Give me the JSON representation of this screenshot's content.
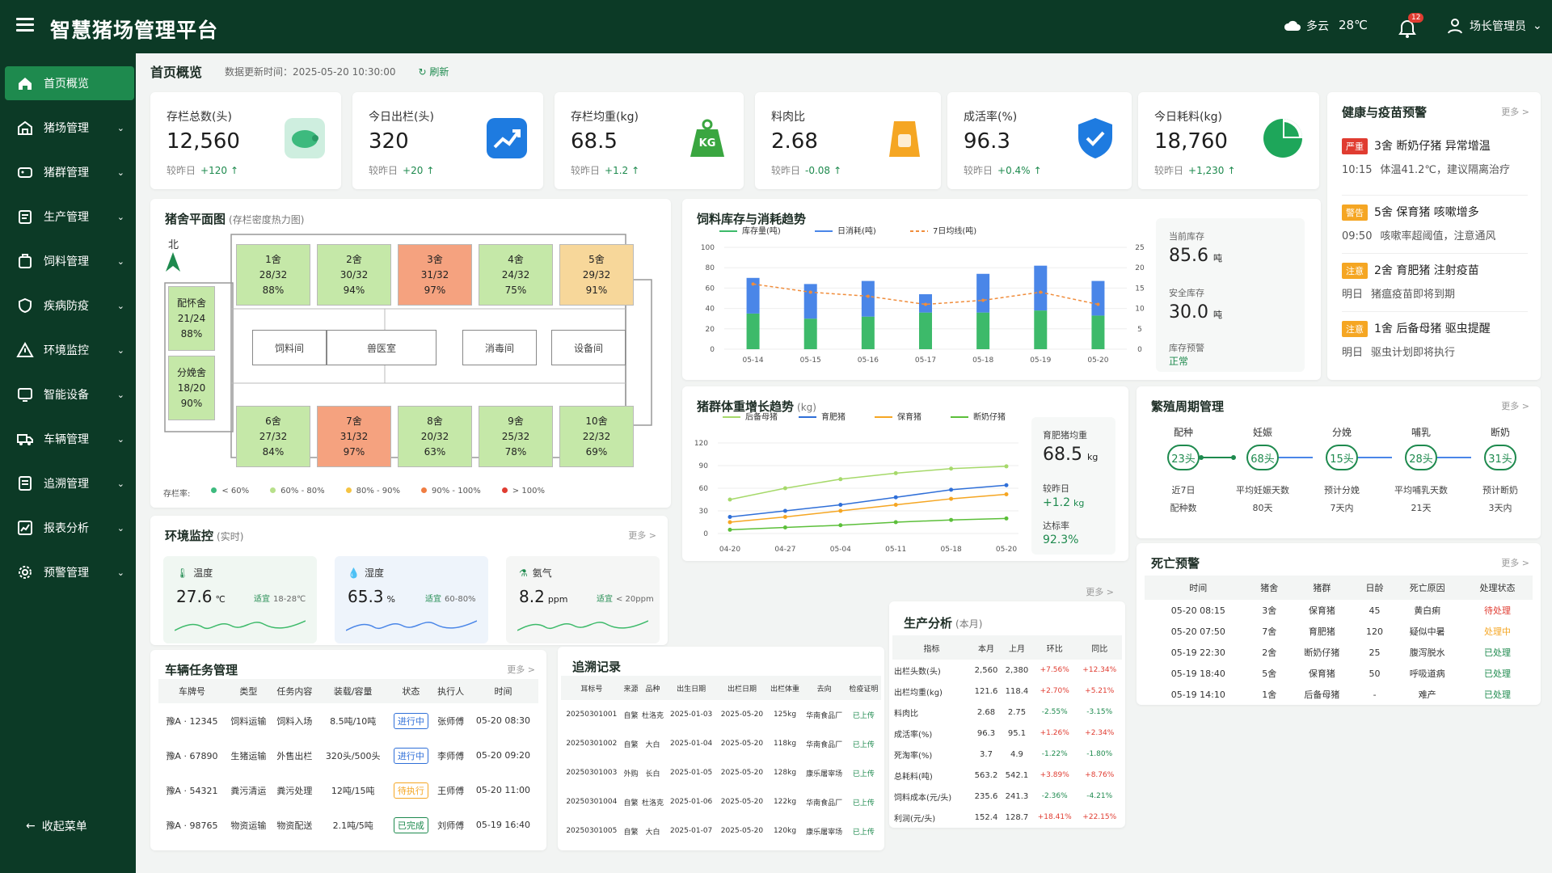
{
  "app": {
    "title": "智慧猪场管理平台"
  },
  "topbar": {
    "weather": "多云",
    "temperature": "28℃",
    "notifications": "12",
    "user": "场长管理员"
  },
  "colors": {
    "brand": "#0c3a26",
    "accent": "#1e8a4e",
    "danger": "#e03c31",
    "warning": "#f5a623"
  },
  "sidebar": {
    "items": [
      {
        "label": "首页概览",
        "icon": "home-icon",
        "active": true
      },
      {
        "label": "猪场管理",
        "icon": "farm-icon"
      },
      {
        "label": "猪群管理",
        "icon": "herd-icon"
      },
      {
        "label": "生产管理",
        "icon": "production-icon"
      },
      {
        "label": "饲料管理",
        "icon": "feed-icon"
      },
      {
        "label": "疾病防疫",
        "icon": "shield-icon"
      },
      {
        "label": "环境监控",
        "icon": "warning-icon"
      },
      {
        "label": "智能设备",
        "icon": "device-icon"
      },
      {
        "label": "车辆管理",
        "icon": "truck-icon"
      },
      {
        "label": "追溯管理",
        "icon": "trace-icon"
      },
      {
        "label": "报表分析",
        "icon": "report-icon"
      },
      {
        "label": "预警管理",
        "icon": "gear-icon"
      }
    ],
    "collapse": "收起菜单"
  },
  "page": {
    "title": "首页概览",
    "update_time": "数据更新时间：2025-05-20 10:30:00",
    "refresh": "刷新"
  },
  "kpis": [
    {
      "label": "存栏总数(头)",
      "value": "12,560",
      "compare": "较昨日",
      "delta": "+120",
      "icon": "pig-icon",
      "color": "#3dba7e"
    },
    {
      "label": "今日出栏(头)",
      "value": "320",
      "compare": "较昨日",
      "delta": "+20",
      "icon": "trend-up-icon",
      "color": "#1e7be0"
    },
    {
      "label": "存栏均重(kg)",
      "value": "68.5",
      "compare": "较昨日",
      "delta": "+1.2",
      "icon": "weight-icon",
      "color": "#3aa640",
      "icon_text": "KG"
    },
    {
      "label": "料肉比",
      "value": "2.68",
      "compare": "较昨日",
      "delta": "-0.08",
      "icon": "feed-bag-icon",
      "color": "#f5a623"
    },
    {
      "label": "成活率(%)",
      "value": "96.3",
      "compare": "较昨日",
      "delta": "+0.4%",
      "icon": "shield-check-icon",
      "color": "#1e7be0"
    },
    {
      "label": "今日耗料(kg)",
      "value": "18,760",
      "compare": "较昨日",
      "delta": "+1,230",
      "icon": "pie-icon",
      "color": "#1ea65a"
    }
  ],
  "floorplan": {
    "title": "猪舍平面图",
    "subtitle": "(存栏密度热力图)",
    "north": "北",
    "rooms_top": [
      {
        "name": "1舍",
        "count": "28/32",
        "rate": "88%",
        "color": "#c5e8a8"
      },
      {
        "name": "2舍",
        "count": "30/32",
        "rate": "94%",
        "color": "#c5e8a8"
      },
      {
        "name": "3舍",
        "count": "31/32",
        "rate": "97%",
        "color": "#f5a27f"
      },
      {
        "name": "4舍",
        "count": "24/32",
        "rate": "75%",
        "color": "#c5e8a8"
      },
      {
        "name": "5舍",
        "count": "29/32",
        "rate": "91%",
        "color": "#f7d79a"
      }
    ],
    "rooms_bottom": [
      {
        "name": "6舍",
        "count": "27/32",
        "rate": "84%",
        "color": "#c5e8a8"
      },
      {
        "name": "7舍",
        "count": "31/32",
        "rate": "97%",
        "color": "#f5a27f"
      },
      {
        "name": "8舍",
        "count": "20/32",
        "rate": "63%",
        "color": "#c5e8a8"
      },
      {
        "name": "9舍",
        "count": "25/32",
        "rate": "78%",
        "color": "#c5e8a8"
      },
      {
        "name": "10舍",
        "count": "22/32",
        "rate": "69%",
        "color": "#c5e8a8"
      }
    ],
    "side_rooms": [
      {
        "name": "配怀舍",
        "count": "21/24",
        "rate": "88%"
      },
      {
        "name": "分娩舍",
        "count": "18/20",
        "rate": "90%"
      }
    ],
    "facilities": [
      "饲料间",
      "兽医室",
      "消毒间",
      "设备间"
    ],
    "legend_title": "存栏率:",
    "legend": [
      {
        "label": "< 60%",
        "color": "#3dba7e"
      },
      {
        "label": "60% - 80%",
        "color": "#b7e08a"
      },
      {
        "label": "80% - 90%",
        "color": "#f5c443"
      },
      {
        "label": "90% - 100%",
        "color": "#f07d42"
      },
      {
        "label": "> 100%",
        "color": "#e03c31"
      }
    ]
  },
  "env": {
    "title": "环境监控",
    "subtitle": "(实时)",
    "more": "更多 >",
    "items": [
      {
        "name": "温度",
        "value": "27.6",
        "unit": "℃",
        "range_label": "适宜",
        "range": "18-28℃",
        "icon": "thermometer-icon"
      },
      {
        "name": "湿度",
        "value": "65.3",
        "unit": "%",
        "range_label": "适宜",
        "range": "60-80%",
        "icon": "droplet-icon"
      },
      {
        "name": "氨气",
        "value": "8.2",
        "unit": "ppm",
        "range_label": "适宜",
        "range": "< 20ppm",
        "icon": "gas-icon"
      }
    ]
  },
  "feed": {
    "title": "饲料库存与消耗趋势",
    "legend": [
      "库存量(吨)",
      "日消耗(吨)",
      "7日均线(吨)"
    ],
    "side": {
      "current_label": "当前库存",
      "current": "85.6",
      "unit": "吨",
      "safe_label": "安全库存",
      "safe": "30.0",
      "alert_label": "库存预警",
      "alert": "正常"
    }
  },
  "weight": {
    "title": "猪群体重增长趋势",
    "subtitle": "(kg)",
    "side": {
      "avg_label": "育肥猪均重",
      "avg": "68.5",
      "unit": "kg",
      "compare_label": "较昨日",
      "compare": "+1.2",
      "rate_label": "达标率",
      "rate": "92.3%"
    }
  },
  "chart_data": [
    {
      "type": "bar",
      "categories": [
        "05-14",
        "05-15",
        "05-16",
        "05-17",
        "05-18",
        "05-19",
        "05-20"
      ],
      "series": [
        {
          "name": "库存量(吨)",
          "values": [
            35,
            30,
            32,
            36,
            36,
            38,
            33
          ],
          "color": "#3dba6a",
          "stack": "total"
        },
        {
          "name": "日消耗(吨)",
          "values": [
            35,
            34,
            35,
            18,
            38,
            44,
            34
          ],
          "color": "#4a86e8",
          "stack": "total"
        },
        {
          "name": "7日均线(吨)",
          "values": [
            16,
            14,
            13,
            11,
            12,
            14,
            11
          ],
          "color": "#f08d3c",
          "type": "line",
          "axis": "right"
        }
      ],
      "ylim": [
        0,
        100
      ],
      "yticks": [
        0,
        20,
        40,
        60,
        80,
        100
      ],
      "y2lim": [
        0,
        25
      ],
      "y2ticks": [
        0,
        5,
        10,
        15,
        20,
        25
      ],
      "grid": true,
      "legend": "top-left"
    },
    {
      "type": "line",
      "categories": [
        "04-20",
        "04-27",
        "05-04",
        "05-11",
        "05-18",
        "05-20"
      ],
      "series": [
        {
          "name": "后备母猪",
          "values": [
            45,
            60,
            72,
            80,
            86,
            89
          ],
          "color": "#a6d96a"
        },
        {
          "name": "育肥猪",
          "values": [
            22,
            30,
            38,
            48,
            58,
            64
          ],
          "color": "#2f6fd8"
        },
        {
          "name": "保育猪",
          "values": [
            15,
            22,
            30,
            38,
            46,
            52
          ],
          "color": "#f5a623"
        },
        {
          "name": "断奶仔猪",
          "values": [
            5,
            8,
            11,
            15,
            18,
            20
          ],
          "color": "#5cbf3a"
        }
      ],
      "ylim": [
        0,
        120
      ],
      "yticks": [
        0,
        30,
        60,
        90,
        120
      ],
      "grid": true,
      "legend": "top-left"
    }
  ],
  "warnings": {
    "title": "健康与疫苗预警",
    "more": "更多 >",
    "items": [
      {
        "tag": "严重",
        "tag_color": "#e03c31",
        "title": "3舍 断奶仔猪 异常增温",
        "time": "10:15",
        "desc": "体温41.2℃，建议隔离治疗"
      },
      {
        "tag": "警告",
        "tag_color": "#f5a623",
        "title": "5舍 保育猪 咳嗽增多",
        "time": "09:50",
        "desc": "咳嗽率超阈值，注意通风"
      },
      {
        "tag": "注意",
        "tag_color": "#f5a623",
        "title": "2舍 育肥猪 注射疫苗",
        "time": "明日",
        "desc": "猪瘟疫苗即将到期"
      },
      {
        "tag": "注意",
        "tag_color": "#f5a623",
        "title": "1舍 后备母猪 驱虫提醒",
        "time": "明日",
        "desc": "驱虫计划即将执行"
      }
    ]
  },
  "breeding": {
    "title": "繁殖周期管理",
    "more": "更多 >",
    "stages": [
      {
        "label": "配种",
        "value": "23头",
        "sub1": "近7日",
        "sub2": "配种数"
      },
      {
        "label": "妊娠",
        "value": "68头",
        "sub1": "平均妊娠天数",
        "sub2": "80天"
      },
      {
        "label": "分娩",
        "value": "15头",
        "sub1": "预计分娩",
        "sub2": "7天内"
      },
      {
        "label": "哺乳",
        "value": "28头",
        "sub1": "平均哺乳天数",
        "sub2": "21天"
      },
      {
        "label": "断奶",
        "value": "31头",
        "sub1": "预计断奶",
        "sub2": "3天内"
      }
    ]
  },
  "death": {
    "title": "死亡预警",
    "more": "更多 >",
    "headers": [
      "时间",
      "猪舍",
      "猪群",
      "日龄",
      "死亡原因",
      "处理状态"
    ],
    "rows": [
      {
        "time": "05-20 08:15",
        "house": "3舍",
        "group": "保育猪",
        "age": "45",
        "cause": "黄白痢",
        "status": "待处理",
        "color": "#e03c31"
      },
      {
        "time": "05-20 07:50",
        "house": "7舍",
        "group": "育肥猪",
        "age": "120",
        "cause": "疑似中暑",
        "status": "处理中",
        "color": "#f5a623"
      },
      {
        "time": "05-19 22:30",
        "house": "2舍",
        "group": "断奶仔猪",
        "age": "25",
        "cause": "腹泻脱水",
        "status": "已处理",
        "color": "#1e8a4e"
      },
      {
        "time": "05-19 18:40",
        "house": "5舍",
        "group": "保育猪",
        "age": "50",
        "cause": "呼吸道病",
        "status": "已处理",
        "color": "#1e8a4e"
      },
      {
        "time": "05-19 14:10",
        "house": "1舍",
        "group": "后备母猪",
        "age": "-",
        "cause": "难产",
        "status": "已处理",
        "color": "#1e8a4e"
      }
    ]
  },
  "vehicles": {
    "title": "车辆任务管理",
    "more": "更多 >",
    "headers": [
      "车牌号",
      "类型",
      "任务内容",
      "装载/容量",
      "状态",
      "执行人",
      "时间"
    ],
    "rows": [
      {
        "plate": "豫A · 12345",
        "type": "饲料运输",
        "task": "饲料入场",
        "load": "8.5吨/10吨",
        "status": "进行中",
        "color": "#2f6fd8",
        "person": "张师傅",
        "time": "05-20 08:30"
      },
      {
        "plate": "豫A · 67890",
        "type": "生猪运输",
        "task": "外售出栏",
        "load": "320头/500头",
        "status": "进行中",
        "color": "#2f6fd8",
        "person": "李师傅",
        "time": "05-20 09:20"
      },
      {
        "plate": "豫A · 54321",
        "type": "粪污清运",
        "task": "粪污处理",
        "load": "12吨/15吨",
        "status": "待执行",
        "color": "#f5a623",
        "person": "王师傅",
        "time": "05-20 11:00"
      },
      {
        "plate": "豫A · 98765",
        "type": "物资运输",
        "task": "物资配送",
        "load": "2.1吨/5吨",
        "status": "已完成",
        "color": "#1e8a4e",
        "person": "刘师傅",
        "time": "05-19 16:40"
      }
    ]
  },
  "trace": {
    "title": "追溯记录",
    "headers": [
      "耳标号",
      "来源",
      "品种",
      "出生日期",
      "出栏日期",
      "出栏体重",
      "去向",
      "检疫证明"
    ],
    "rows": [
      {
        "ear": "20250301001",
        "src": "自繁",
        "breed": "杜洛克",
        "birth": "2025-01-03",
        "out": "2025-05-20",
        "weight": "125kg",
        "dest": "华南食品厂",
        "cert": "已上传"
      },
      {
        "ear": "20250301002",
        "src": "自繁",
        "breed": "大白",
        "birth": "2025-01-04",
        "out": "2025-05-20",
        "weight": "118kg",
        "dest": "华南食品厂",
        "cert": "已上传"
      },
      {
        "ear": "20250301003",
        "src": "外购",
        "breed": "长白",
        "birth": "2025-01-05",
        "out": "2025-05-20",
        "weight": "128kg",
        "dest": "康乐屠宰场",
        "cert": "已上传"
      },
      {
        "ear": "20250301004",
        "src": "自繁",
        "breed": "杜洛克",
        "birth": "2025-01-06",
        "out": "2025-05-20",
        "weight": "122kg",
        "dest": "华南食品厂",
        "cert": "已上传"
      },
      {
        "ear": "20250301005",
        "src": "自繁",
        "breed": "大白",
        "birth": "2025-01-07",
        "out": "2025-05-20",
        "weight": "120kg",
        "dest": "康乐屠宰场",
        "cert": "已上传"
      }
    ]
  },
  "production": {
    "title": "生产分析",
    "subtitle": "(本月)",
    "more": "更多 >",
    "headers": [
      "指标",
      "本月",
      "上月",
      "环比",
      "同比"
    ],
    "rows": [
      {
        "name": "出栏头数(头)",
        "cur": "2,560",
        "prev": "2,380",
        "mom": "+7.56%",
        "yoy": "+12.34%",
        "mom_color": "#e03c31",
        "yoy_color": "#e03c31"
      },
      {
        "name": "出栏均重(kg)",
        "cur": "121.6",
        "prev": "118.4",
        "mom": "+2.70%",
        "yoy": "+5.21%",
        "mom_color": "#e03c31",
        "yoy_color": "#e03c31"
      },
      {
        "name": "料肉比",
        "cur": "2.68",
        "prev": "2.75",
        "mom": "-2.55%",
        "yoy": "-3.15%",
        "mom_color": "#1e8a4e",
        "yoy_color": "#1e8a4e"
      },
      {
        "name": "成活率(%)",
        "cur": "96.3",
        "prev": "95.1",
        "mom": "+1.26%",
        "yoy": "+2.34%",
        "mom_color": "#e03c31",
        "yoy_color": "#e03c31"
      },
      {
        "name": "死淘率(%)",
        "cur": "3.7",
        "prev": "4.9",
        "mom": "-1.22%",
        "yoy": "-1.80%",
        "mom_color": "#1e8a4e",
        "yoy_color": "#1e8a4e"
      },
      {
        "name": "总耗料(吨)",
        "cur": "563.2",
        "prev": "542.1",
        "mom": "+3.89%",
        "yoy": "+8.76%",
        "mom_color": "#e03c31",
        "yoy_color": "#e03c31"
      },
      {
        "name": "饲料成本(元/头)",
        "cur": "235.6",
        "prev": "241.3",
        "mom": "-2.36%",
        "yoy": "-4.21%",
        "mom_color": "#1e8a4e",
        "yoy_color": "#1e8a4e"
      },
      {
        "name": "利润(元/头)",
        "cur": "152.4",
        "prev": "128.7",
        "mom": "+18.41%",
        "yoy": "+22.15%",
        "mom_color": "#e03c31",
        "yoy_color": "#e03c31"
      }
    ]
  }
}
